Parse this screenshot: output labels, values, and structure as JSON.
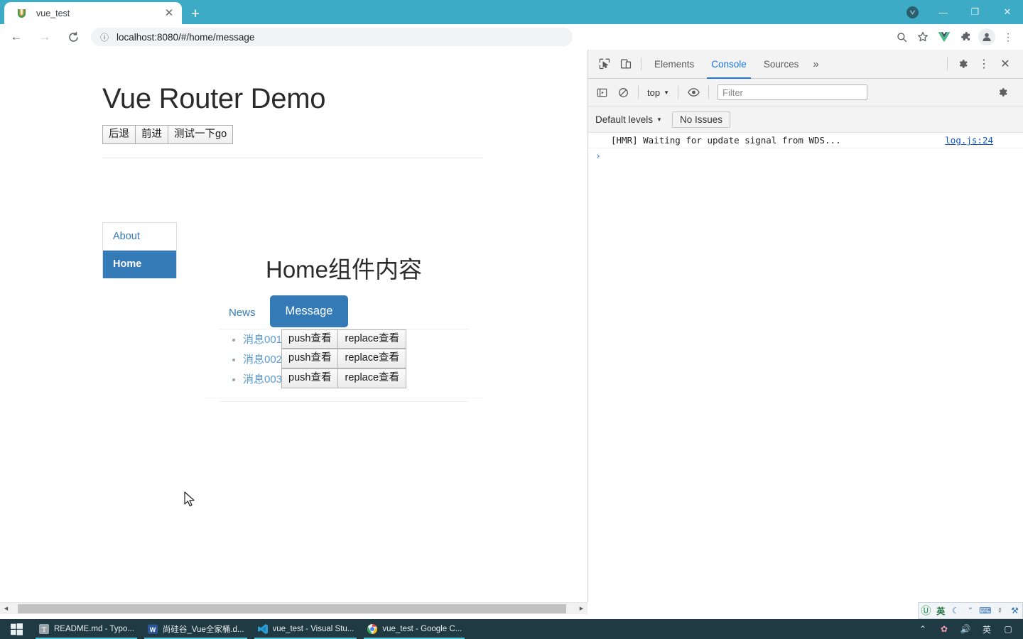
{
  "browser": {
    "tab": {
      "title": "vue_test",
      "favicon_icon": "vue-u-favicon",
      "close_icon": "close-icon"
    },
    "new_tab_label": "+",
    "window_controls": {
      "extra_icon": "vue-devtools-window-icon",
      "minimize": "—",
      "maximize": "❐",
      "close": "✕"
    },
    "nav": {
      "back_icon": "back-arrow-icon",
      "forward_icon": "forward-arrow-icon",
      "reload_icon": "reload-icon"
    },
    "omnibox": {
      "info_icon": "site-info-icon",
      "url": "localhost:8080/#/home/message"
    },
    "toolbar_icons": [
      {
        "name": "zoom-icon",
        "glyph": "⌕"
      },
      {
        "name": "bookmark-star-icon",
        "glyph": "☆"
      },
      {
        "name": "vue-devtools-icon",
        "glyph": "V"
      },
      {
        "name": "extensions-puzzle-icon",
        "glyph": "❖"
      },
      {
        "name": "profile-avatar-icon",
        "glyph": "●"
      },
      {
        "name": "chrome-menu-icon",
        "glyph": "⋮"
      }
    ]
  },
  "page": {
    "title": "Vue Router Demo",
    "nav_buttons": [
      {
        "label": "后退"
      },
      {
        "label": "前进"
      },
      {
        "label": "测试一下go"
      }
    ],
    "sidebar": [
      {
        "label": "About",
        "active": false
      },
      {
        "label": "Home",
        "active": true
      }
    ],
    "content_heading": "Home组件内容",
    "tabs": [
      {
        "label": "News",
        "active": false
      },
      {
        "label": "Message",
        "active": true
      }
    ],
    "messages": [
      {
        "link": "消息001",
        "push_label": "push查看",
        "replace_label": "replace查看"
      },
      {
        "link": "消息002",
        "push_label": "push查看",
        "replace_label": "replace查看"
      },
      {
        "link": "消息003",
        "push_label": "push查看",
        "replace_label": "replace查看"
      }
    ],
    "accent_color": "#337ab7",
    "link_color": "#5b9bd5"
  },
  "devtools": {
    "left_icons": [
      {
        "name": "inspect-element-icon"
      },
      {
        "name": "device-toolbar-icon"
      }
    ],
    "tabs": [
      {
        "label": "Elements",
        "active": false
      },
      {
        "label": "Console",
        "active": true
      },
      {
        "label": "Sources",
        "active": false
      }
    ],
    "more_tabs_label": "»",
    "right_icons": [
      {
        "name": "devtools-settings-gear-icon"
      },
      {
        "name": "devtools-more-options-icon"
      },
      {
        "name": "devtools-close-icon"
      }
    ],
    "console_toolbar": {
      "sidebar_toggle_icon": "console-sidebar-icon",
      "clear_icon": "clear-console-icon",
      "context": "top",
      "eye_icon": "live-expression-eye-icon",
      "filter_placeholder": "Filter",
      "settings_icon": "console-settings-gear-icon"
    },
    "levels_bar": {
      "levels_label": "Default levels",
      "issues_label": "No Issues"
    },
    "console_logs": [
      {
        "message": "[HMR] Waiting for update signal from WDS...",
        "source": "log.js:24"
      }
    ],
    "prompt_caret": "›",
    "active_tab_color": "#1a73e8"
  },
  "ime_bar": {
    "items": [
      {
        "name": "ime-logo-icon",
        "glyph": "Ⓤ"
      },
      {
        "name": "ime-chinese-mode",
        "glyph": "英"
      },
      {
        "name": "ime-moon-icon",
        "glyph": "☾"
      },
      {
        "name": "ime-punctuation-icon",
        "glyph": "“"
      },
      {
        "name": "ime-keyboard-icon",
        "glyph": "⌨"
      },
      {
        "name": "ime-user-icon",
        "glyph": "☿"
      },
      {
        "name": "ime-tools-icon",
        "glyph": "⚒"
      }
    ]
  },
  "taskbar": {
    "start_icon": "windows-start-icon",
    "tasks": [
      {
        "label": "README.md - Typo...",
        "icon": "typora-icon"
      },
      {
        "label": "尚硅谷_Vue全家桶.d...",
        "icon": "word-icon"
      },
      {
        "label": "vue_test - Visual Stu...",
        "icon": "vscode-icon"
      },
      {
        "label": "vue_test - Google C...",
        "icon": "chrome-icon"
      }
    ],
    "tray": [
      {
        "name": "tray-show-hidden-icon",
        "glyph": "⌃"
      },
      {
        "name": "tray-antivirus-icon",
        "glyph": "✿"
      },
      {
        "name": "tray-volume-icon",
        "glyph": "🔊"
      },
      {
        "name": "tray-ime-icon",
        "glyph": "英"
      },
      {
        "name": "tray-notifications-icon",
        "glyph": "▢"
      }
    ]
  }
}
